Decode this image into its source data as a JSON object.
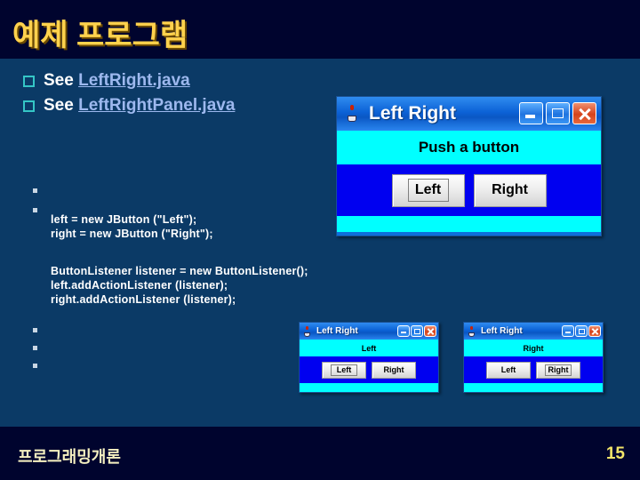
{
  "slide": {
    "title": "예제 프로그램",
    "background_color": "#0b3a66",
    "band_color": "#00042e",
    "title_color": "#ffd24d"
  },
  "bullets": [
    {
      "icon": "checkbox-icon",
      "prefix": "See ",
      "link": "LeftRight.java"
    },
    {
      "icon": "checkbox-icon",
      "prefix": "See ",
      "link": "LeftRightPanel.java"
    }
  ],
  "code": {
    "block_a": "left = new JButton (\"Left\");\nright = new JButton (\"Right\");",
    "block_b": "ButtonListener listener = new ButtonListener();\nleft.addActionListener (listener);\nright.addActionListener (listener);"
  },
  "windows": {
    "main": {
      "title": "Left Right",
      "icon": "java-coffee-cup-icon",
      "label": "Push a button",
      "buttons": [
        "Left",
        "Right"
      ],
      "focused_button": "Left",
      "minimize_label": "Minimize",
      "maximize_label": "Maximize",
      "close_label": "Close"
    },
    "left_pressed": {
      "title": "Left Right",
      "icon": "java-coffee-cup-icon",
      "label": "Left",
      "buttons": [
        "Left",
        "Right"
      ],
      "focused_button": "Left"
    },
    "right_pressed": {
      "title": "Left Right",
      "icon": "java-coffee-cup-icon",
      "label": "Right",
      "buttons": [
        "Left",
        "Right"
      ],
      "focused_button": "Right"
    }
  },
  "footer": {
    "course": "프로그래밍개론",
    "page": "15"
  }
}
